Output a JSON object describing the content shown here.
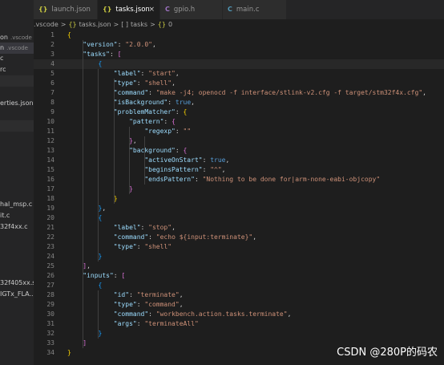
{
  "sidebar": {
    "items": [
      {
        "label": "on",
        "extra": ".vscode",
        "selected": false
      },
      {
        "label": "n",
        "extra": ".vscode",
        "selected": true
      },
      {
        "label": "c",
        "extra": "",
        "selected": false
      },
      {
        "label": "rc",
        "extra": "",
        "selected": false
      },
      {
        "label": "",
        "extra": "",
        "selected": false,
        "band": true
      },
      {
        "label": "erties.json",
        "extra": "",
        "selected": false
      },
      {
        "label": "",
        "extra": "",
        "selected": false,
        "band": true
      },
      {
        "label": "hal_msp.c",
        "extra": "",
        "selected": false
      },
      {
        "label": "it.c",
        "extra": "",
        "selected": false
      },
      {
        "label": "32f4xx.c",
        "extra": "",
        "selected": false
      },
      {
        "label": "32f405xx.s",
        "extra": "",
        "selected": false
      },
      {
        "label": "IGTx_FLA...",
        "extra": "",
        "selected": false
      }
    ]
  },
  "tabs": [
    {
      "icon": "{}",
      "icon_type": "json",
      "label": "launch.json",
      "active": false
    },
    {
      "icon": "{}",
      "icon_type": "json",
      "label": "tasks.json",
      "active": true,
      "close": "×"
    },
    {
      "icon": "C",
      "icon_type": "h",
      "label": "gpio.h",
      "active": false
    },
    {
      "icon": "C",
      "icon_type": "c",
      "label": "main.c",
      "active": false
    }
  ],
  "breadcrumb": [
    ".vscode",
    ">",
    "{}",
    "tasks.json",
    ">",
    "[ ]",
    "tasks",
    ">",
    "{}",
    "0"
  ],
  "code_lines": [
    {
      "n": "1",
      "tokens": [
        [
          "{",
          "br1"
        ]
      ]
    },
    {
      "n": "2",
      "tokens": [
        [
          "    ",
          "p"
        ],
        [
          "\"version\"",
          "k"
        ],
        [
          ": ",
          "p"
        ],
        [
          "\"2.0.0\"",
          "s"
        ],
        [
          ",",
          "p"
        ]
      ]
    },
    {
      "n": "3",
      "tokens": [
        [
          "    ",
          "p"
        ],
        [
          "\"tasks\"",
          "k"
        ],
        [
          ": ",
          "p"
        ],
        [
          "[",
          "br2"
        ]
      ]
    },
    {
      "n": "4",
      "tokens": [
        [
          "        ",
          "p"
        ],
        [
          "{",
          "br3"
        ]
      ]
    },
    {
      "n": "5",
      "tokens": [
        [
          "            ",
          "p"
        ],
        [
          "\"label\"",
          "k"
        ],
        [
          ": ",
          "p"
        ],
        [
          "\"start\"",
          "s"
        ],
        [
          ",",
          "p"
        ]
      ]
    },
    {
      "n": "6",
      "tokens": [
        [
          "            ",
          "p"
        ],
        [
          "\"type\"",
          "k"
        ],
        [
          ": ",
          "p"
        ],
        [
          "\"shell\"",
          "s"
        ],
        [
          ",",
          "p"
        ]
      ]
    },
    {
      "n": "7",
      "tokens": [
        [
          "            ",
          "p"
        ],
        [
          "\"command\"",
          "k"
        ],
        [
          ": ",
          "p"
        ],
        [
          "\"make -j4; openocd -f interface/stlink-v2.cfg -f target/stm32f4x.cfg\"",
          "s"
        ],
        [
          ",",
          "p"
        ]
      ]
    },
    {
      "n": "8",
      "tokens": [
        [
          "            ",
          "p"
        ],
        [
          "\"isBackground\"",
          "k"
        ],
        [
          ": ",
          "p"
        ],
        [
          "true",
          "b"
        ],
        [
          ",",
          "p"
        ]
      ]
    },
    {
      "n": "9",
      "tokens": [
        [
          "            ",
          "p"
        ],
        [
          "\"problemMatcher\"",
          "k"
        ],
        [
          ": ",
          "p"
        ],
        [
          "{",
          "br1"
        ]
      ]
    },
    {
      "n": "10",
      "tokens": [
        [
          "                ",
          "p"
        ],
        [
          "\"pattern\"",
          "k"
        ],
        [
          ": ",
          "p"
        ],
        [
          "{",
          "br2"
        ]
      ]
    },
    {
      "n": "11",
      "tokens": [
        [
          "                    ",
          "p"
        ],
        [
          "\"regexp\"",
          "k"
        ],
        [
          ": ",
          "p"
        ],
        [
          "\"\"",
          "s"
        ]
      ]
    },
    {
      "n": "12",
      "tokens": [
        [
          "                ",
          "p"
        ],
        [
          "}",
          "br2"
        ],
        [
          ",",
          "p"
        ]
      ]
    },
    {
      "n": "13",
      "tokens": [
        [
          "                ",
          "p"
        ],
        [
          "\"background\"",
          "k"
        ],
        [
          ": ",
          "p"
        ],
        [
          "{",
          "br2"
        ]
      ]
    },
    {
      "n": "14",
      "tokens": [
        [
          "                    ",
          "p"
        ],
        [
          "\"activeOnStart\"",
          "k"
        ],
        [
          ": ",
          "p"
        ],
        [
          "true",
          "b"
        ],
        [
          ",",
          "p"
        ]
      ]
    },
    {
      "n": "15",
      "tokens": [
        [
          "                    ",
          "p"
        ],
        [
          "\"beginsPattern\"",
          "k"
        ],
        [
          ": ",
          "p"
        ],
        [
          "\"^\"",
          "s"
        ],
        [
          ",",
          "p"
        ]
      ]
    },
    {
      "n": "16",
      "tokens": [
        [
          "                    ",
          "p"
        ],
        [
          "\"endsPattern\"",
          "k"
        ],
        [
          ": ",
          "p"
        ],
        [
          "\"Nothing to be done for|arm-none-eabi-objcopy\"",
          "s"
        ]
      ]
    },
    {
      "n": "17",
      "tokens": [
        [
          "                ",
          "p"
        ],
        [
          "}",
          "br2"
        ]
      ]
    },
    {
      "n": "18",
      "tokens": [
        [
          "            ",
          "p"
        ],
        [
          "}",
          "br1"
        ]
      ]
    },
    {
      "n": "19",
      "tokens": [
        [
          "        ",
          "p"
        ],
        [
          "}",
          "br3"
        ],
        [
          ",",
          "p"
        ]
      ]
    },
    {
      "n": "20",
      "tokens": [
        [
          "        ",
          "p"
        ],
        [
          "{",
          "br3"
        ]
      ]
    },
    {
      "n": "21",
      "tokens": [
        [
          "            ",
          "p"
        ],
        [
          "\"label\"",
          "k"
        ],
        [
          ": ",
          "p"
        ],
        [
          "\"stop\"",
          "s"
        ],
        [
          ",",
          "p"
        ]
      ]
    },
    {
      "n": "22",
      "tokens": [
        [
          "            ",
          "p"
        ],
        [
          "\"command\"",
          "k"
        ],
        [
          ": ",
          "p"
        ],
        [
          "\"echo ${input:terminate}\"",
          "s"
        ],
        [
          ",",
          "p"
        ]
      ]
    },
    {
      "n": "23",
      "tokens": [
        [
          "            ",
          "p"
        ],
        [
          "\"type\"",
          "k"
        ],
        [
          ": ",
          "p"
        ],
        [
          "\"shell\"",
          "s"
        ]
      ]
    },
    {
      "n": "24",
      "tokens": [
        [
          "        ",
          "p"
        ],
        [
          "}",
          "br3"
        ]
      ]
    },
    {
      "n": "25",
      "tokens": [
        [
          "    ",
          "p"
        ],
        [
          "]",
          "br2"
        ],
        [
          ",",
          "p"
        ]
      ]
    },
    {
      "n": "26",
      "tokens": [
        [
          "    ",
          "p"
        ],
        [
          "\"inputs\"",
          "k"
        ],
        [
          ": ",
          "p"
        ],
        [
          "[",
          "br2"
        ]
      ]
    },
    {
      "n": "27",
      "tokens": [
        [
          "        ",
          "p"
        ],
        [
          "{",
          "br3"
        ]
      ]
    },
    {
      "n": "28",
      "tokens": [
        [
          "            ",
          "p"
        ],
        [
          "\"id\"",
          "k"
        ],
        [
          ": ",
          "p"
        ],
        [
          "\"terminate\"",
          "s"
        ],
        [
          ",",
          "p"
        ]
      ]
    },
    {
      "n": "29",
      "tokens": [
        [
          "            ",
          "p"
        ],
        [
          "\"type\"",
          "k"
        ],
        [
          ": ",
          "p"
        ],
        [
          "\"command\"",
          "s"
        ],
        [
          ",",
          "p"
        ]
      ]
    },
    {
      "n": "30",
      "tokens": [
        [
          "            ",
          "p"
        ],
        [
          "\"command\"",
          "k"
        ],
        [
          ": ",
          "p"
        ],
        [
          "\"workbench.action.tasks.terminate\"",
          "s"
        ],
        [
          ",",
          "p"
        ]
      ]
    },
    {
      "n": "31",
      "tokens": [
        [
          "            ",
          "p"
        ],
        [
          "\"args\"",
          "k"
        ],
        [
          ": ",
          "p"
        ],
        [
          "\"terminateAll\"",
          "s"
        ]
      ]
    },
    {
      "n": "32",
      "tokens": [
        [
          "        ",
          "p"
        ],
        [
          "}",
          "br3"
        ]
      ]
    },
    {
      "n": "33",
      "tokens": [
        [
          "    ",
          "p"
        ],
        [
          "]",
          "br2"
        ]
      ]
    },
    {
      "n": "34",
      "tokens": [
        [
          "}",
          "br1"
        ]
      ]
    }
  ],
  "current_line": "4",
  "watermark": "CSDN @280P的码农"
}
